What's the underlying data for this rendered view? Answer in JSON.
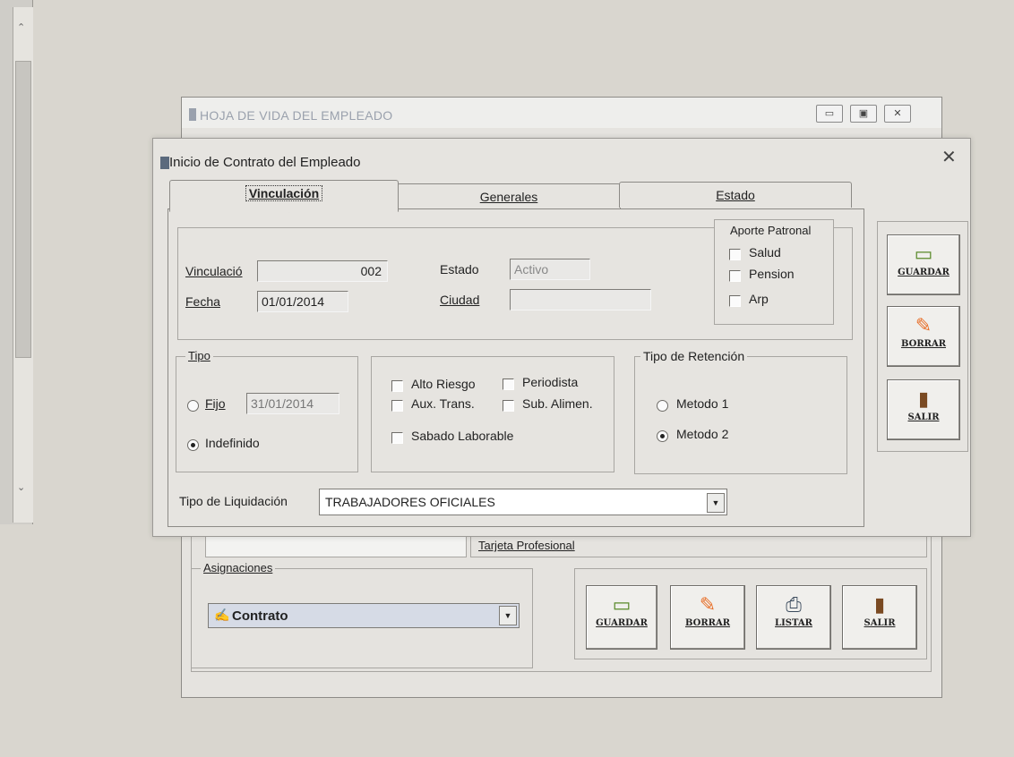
{
  "background_window": {
    "title": "HOJA DE VIDA DEL EMPLEADO",
    "tarjeta_profesional_label": "Tarjeta Profesional",
    "asignaciones": {
      "legend": "Asignaciones",
      "combo_value": "Contrato"
    },
    "buttons": [
      {
        "label": "GUARDAR",
        "icon": "bed-icon"
      },
      {
        "label": "BORRAR",
        "icon": "eraser-icon"
      },
      {
        "label": "LISTAR",
        "icon": "printer-icon"
      },
      {
        "label": "SALIR",
        "icon": "door-icon"
      }
    ]
  },
  "dialog": {
    "title": "Inicio de Contrato del Empleado",
    "close_glyph": "✕",
    "tabs": [
      {
        "label": "Vinculación",
        "active": true
      },
      {
        "label": "Generales",
        "active": false
      },
      {
        "label": "Estado",
        "active": false
      }
    ],
    "vinculacion": {
      "vinculacio_label": "Vinculació",
      "vinculacio_value": "002",
      "fecha_label": "Fecha",
      "fecha_value": "01/01/2014",
      "estado_label": "Estado",
      "estado_value": "Activo",
      "ciudad_label": "Ciudad",
      "ciudad_value": ""
    },
    "aporte_patronal": {
      "legend": "Aporte Patronal",
      "items": [
        "Salud",
        "Pension",
        "Arp"
      ]
    },
    "tipo": {
      "legend": "Tipo",
      "fijo_label": "Fijo",
      "fijo_date": "31/01/2014",
      "indefinido_label": "Indefinido",
      "selected": "Indefinido"
    },
    "options": {
      "alto_riesgo": "Alto Riesgo",
      "periodista": "Periodista",
      "aux_trans": "Aux. Trans.",
      "sub_alimen": "Sub. Alimen.",
      "sabado_laborable": "Sabado Laborable"
    },
    "tipo_retencion": {
      "legend": "Tipo de Retención",
      "metodo1": "Metodo 1",
      "metodo2": "Metodo 2",
      "selected": "Metodo 2"
    },
    "tipo_liquidacion": {
      "label": "Tipo de Liquidación",
      "value": "TRABAJADORES OFICIALES"
    },
    "side_buttons": [
      {
        "label": "GUARDAR",
        "icon": "bed-icon"
      },
      {
        "label": "BORRAR",
        "icon": "eraser-icon"
      },
      {
        "label": "SALIR",
        "icon": "door-icon"
      }
    ]
  },
  "colors": {
    "accent_green": "#5a8a2a",
    "eraser_orange": "#e8702a",
    "door_brown": "#7a4a22"
  }
}
